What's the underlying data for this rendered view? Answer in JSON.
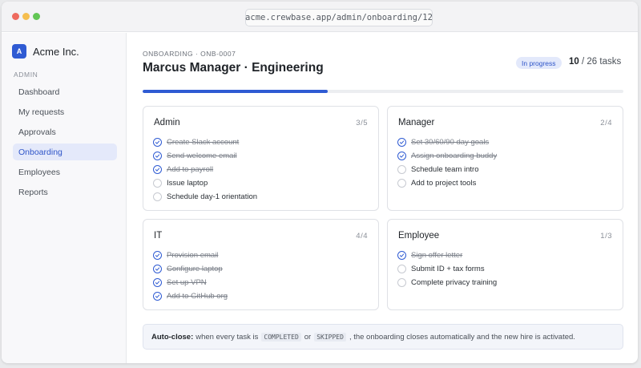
{
  "browser": {
    "url": "acme.crewbase.app/admin/onboarding/12"
  },
  "sidebar": {
    "brand_initial": "A",
    "brand_name": "Acme Inc.",
    "section_label": "ADMIN",
    "items": [
      {
        "label": "Dashboard",
        "active": false
      },
      {
        "label": "My requests",
        "active": false
      },
      {
        "label": "Approvals",
        "active": false
      },
      {
        "label": "Onboarding",
        "active": true
      },
      {
        "label": "Employees",
        "active": false
      },
      {
        "label": "Reports",
        "active": false
      }
    ]
  },
  "header": {
    "eyebrow": "ONBOARDING · ONB-0007",
    "title": "Marcus Manager · Engineering",
    "status": "In progress",
    "tasks_done": "10",
    "tasks_total": "/ 26 tasks",
    "progress_fraction": 0.3846
  },
  "cards": [
    {
      "title": "Admin",
      "count": "3/5",
      "tasks": [
        {
          "label": "Create Slack account",
          "done": true
        },
        {
          "label": "Send welcome email",
          "done": true
        },
        {
          "label": "Add to payroll",
          "done": true
        },
        {
          "label": "Issue laptop",
          "done": false
        },
        {
          "label": "Schedule day-1 orientation",
          "done": false
        }
      ]
    },
    {
      "title": "Manager",
      "count": "2/4",
      "tasks": [
        {
          "label": "Set 30/60/90 day goals",
          "done": true
        },
        {
          "label": "Assign onboarding buddy",
          "done": true
        },
        {
          "label": "Schedule team intro",
          "done": false
        },
        {
          "label": "Add to project tools",
          "done": false
        }
      ]
    },
    {
      "title": "IT",
      "count": "4/4",
      "tasks": [
        {
          "label": "Provision email",
          "done": true
        },
        {
          "label": "Configure laptop",
          "done": true
        },
        {
          "label": "Set up VPN",
          "done": true
        },
        {
          "label": "Add to GitHub org",
          "done": true
        }
      ]
    },
    {
      "title": "Employee",
      "count": "1/3",
      "tasks": [
        {
          "label": "Sign offer letter",
          "done": true
        },
        {
          "label": "Submit ID + tax forms",
          "done": false
        },
        {
          "label": "Complete privacy training",
          "done": false
        }
      ]
    }
  ],
  "note": {
    "label": "Auto-close:",
    "text_1": "when every task is",
    "code_1": "COMPLETED",
    "text_2": "or",
    "code_2": "SKIPPED",
    "text_3": ", the onboarding closes automatically and the new hire is activated."
  },
  "colors": {
    "accent": "#2f5bd3",
    "badge_bg": "#e3e9fb"
  }
}
